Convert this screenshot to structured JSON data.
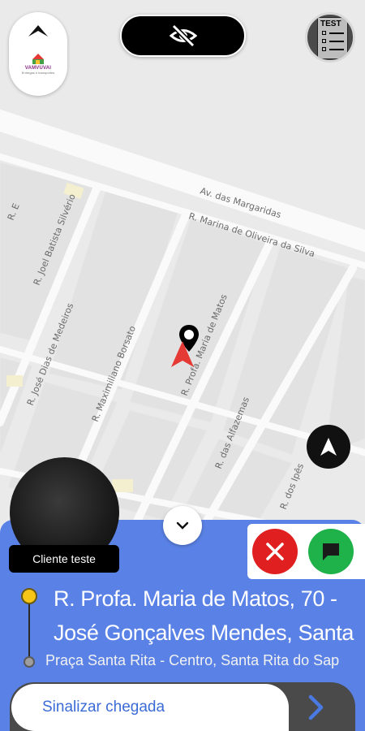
{
  "map": {
    "streets": [
      {
        "id": "margaridas",
        "label": "Av. das Margaridas"
      },
      {
        "id": "marina",
        "label": "R. Marina de Oliveira da Silva"
      },
      {
        "id": "silverio",
        "label": "R. Joel Batista Silvério"
      },
      {
        "id": "medeiros",
        "label": "R. José Dias de Medeiros"
      },
      {
        "id": "borsato",
        "label": "R. Maximiliano Borsato"
      },
      {
        "id": "matos",
        "label": "R. Profa. Maria de Matos"
      },
      {
        "id": "alfazemas",
        "label": "R. das Alfazemas"
      },
      {
        "id": "ipes",
        "label": "R. dos Ipês"
      },
      {
        "id": "re",
        "label": "R. E"
      }
    ]
  },
  "header": {
    "logo_name": "VAMVUVAI",
    "logo_sub": "Entregas e transportes",
    "test_label": "TEST"
  },
  "client": {
    "name": "Cliente teste"
  },
  "trip": {
    "origin_address": "R. Profa. Maria de Matos, 70 - José Gonçalves Mendes, Santa",
    "origin_line1": "R. Profa. Maria de Matos, 70 -",
    "origin_line2": "José Gonçalves Mendes, Santa",
    "destination": "Praça Santa Rita - Centro, Santa Rita do Sap"
  },
  "actions": {
    "arrive_label": "Sinalizar chegada"
  },
  "colors": {
    "panel": "#5a82e6",
    "cancel": "#e02020",
    "chat": "#20b24a",
    "origin_dot": "#f5c518",
    "arrow": "#e53935"
  },
  "icons": {
    "menu": "chevron-up-icon",
    "visibility": "eye-off-icon",
    "test": "test-document-icon",
    "navigate": "navigation-arrow-icon",
    "collapse": "chevron-down-icon",
    "cancel": "close-icon",
    "chat": "chat-bubble-icon",
    "go": "chevron-right-icon"
  }
}
